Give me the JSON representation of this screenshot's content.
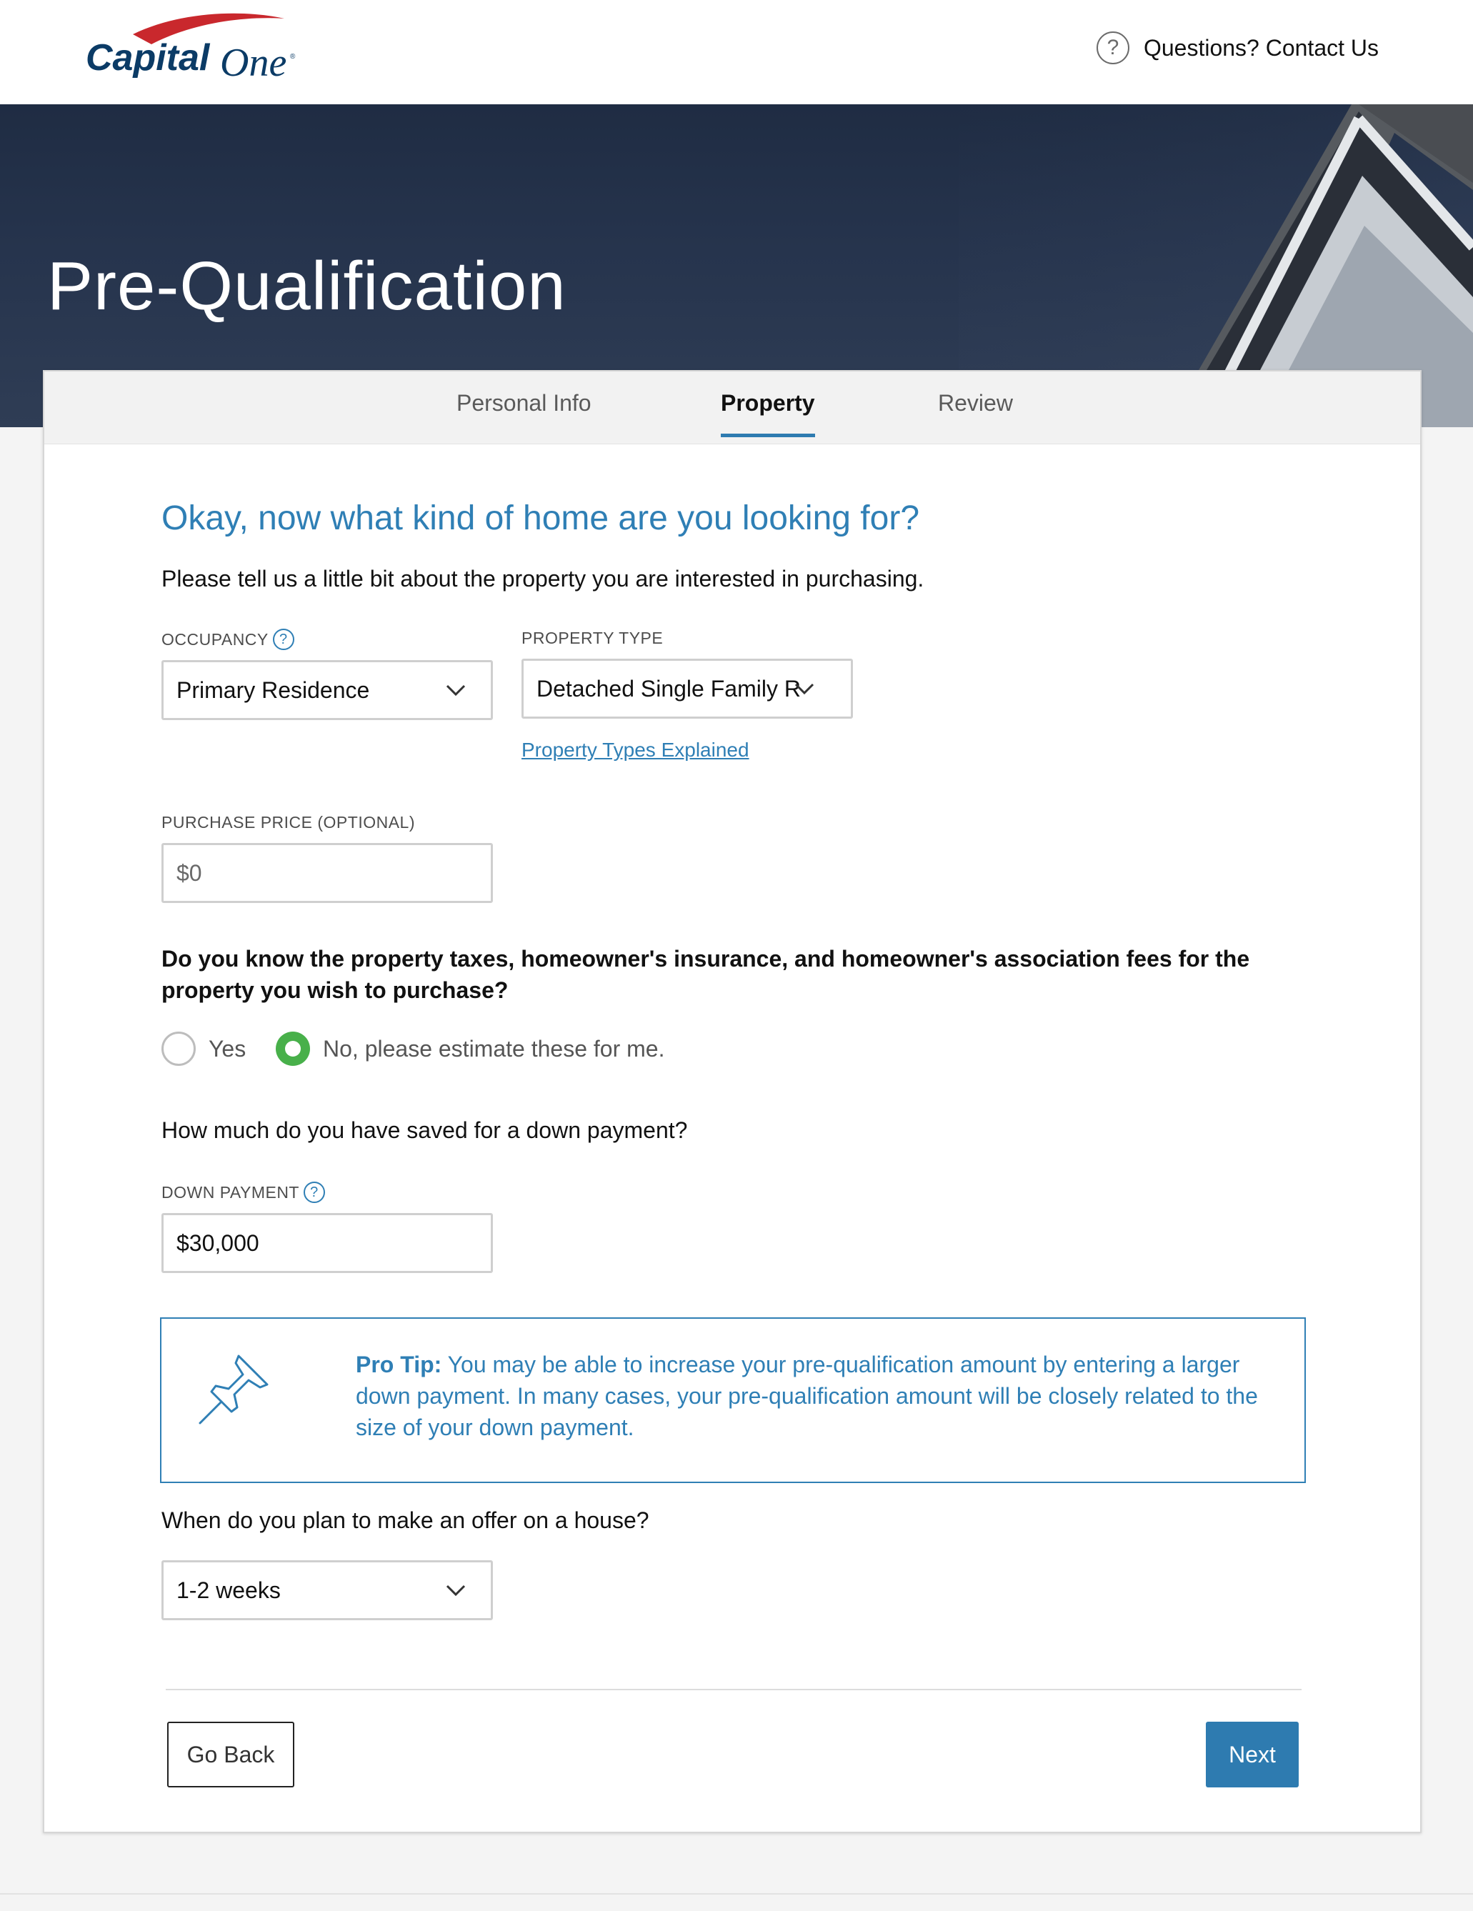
{
  "header": {
    "logo_text": "Capital One",
    "help_label": "Questions? Contact Us",
    "help_icon": "question-circle-icon"
  },
  "hero": {
    "title": "Pre-Qualification"
  },
  "tabs": [
    {
      "label": "Personal Info",
      "active": false
    },
    {
      "label": "Property",
      "active": true
    },
    {
      "label": "Review",
      "active": false
    }
  ],
  "form": {
    "heading": "Okay, now what kind of home are you looking for?",
    "subtext": "Please tell us a little bit about the property you are interested in purchasing.",
    "occupancy": {
      "label": "OCCUPANCY",
      "value": "Primary Residence"
    },
    "property_type": {
      "label": "PROPERTY TYPE",
      "value": "Detached Single Family R",
      "link": "Property Types Explained"
    },
    "purchase_price": {
      "label": "PURCHASE PRICE (OPTIONAL)",
      "placeholder": "$0"
    },
    "taxes_question": "Do you know the property taxes, homeowner's insurance, and homeowner's association fees for the property you wish to purchase?",
    "taxes_options": [
      {
        "label": "Yes",
        "selected": false
      },
      {
        "label": "No, please estimate these for me.",
        "selected": true
      }
    ],
    "down_payment_question": "How much do you have saved for a down payment?",
    "down_payment": {
      "label": "DOWN PAYMENT",
      "value": "$30,000"
    },
    "tip": {
      "strong": "Pro Tip:",
      "text": " You may be able to increase your pre-qualification amount by entering a larger down payment. In many cases, your pre-qualification amount will be closely related to the size of your down payment.",
      "icon": "pushpin-icon"
    },
    "offer_question": "When do you plan to make an offer on a house?",
    "offer_timing": {
      "value": "1-2 weeks"
    }
  },
  "buttons": {
    "back": "Go Back",
    "next": "Next"
  },
  "colors": {
    "accent": "#2f7fb5",
    "selected_radio": "#48b04a",
    "hero_bg": "#26344d"
  }
}
